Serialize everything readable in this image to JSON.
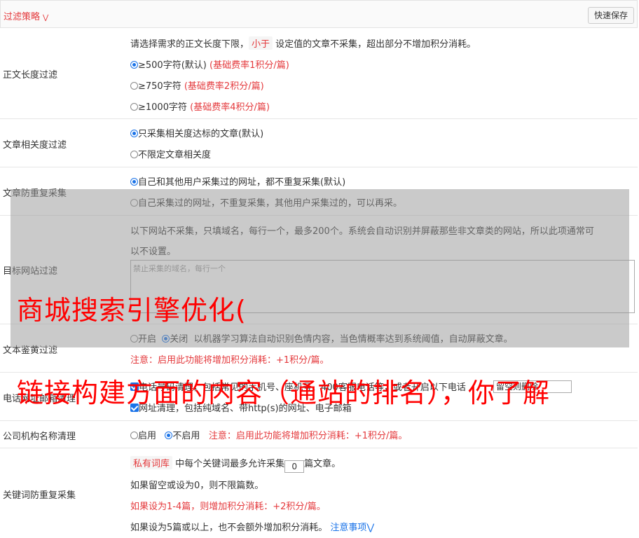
{
  "header": {
    "title": "过滤策略",
    "save_label": "快速保存"
  },
  "length": {
    "label": "正文长度过滤",
    "desc_a": "请选择需求的正文长度下限，",
    "desc_tag": "小于",
    "desc_b": "设定值的文章不采集，超出部分不增加积分消耗。",
    "options": [
      {
        "text": "≥500字符(默认)",
        "note": "(基础费率1积分/篇)",
        "selected": true
      },
      {
        "text": "≥750字符",
        "note": "(基础费率2积分/篇)",
        "selected": false
      },
      {
        "text": "≥1000字符",
        "note": "(基础费率4积分/篇)",
        "selected": false
      }
    ]
  },
  "relevance": {
    "label": "文章相关度过滤",
    "options": [
      "只采集相关度达标的文章(默认)",
      "不限定文章相关度"
    ]
  },
  "dedupe": {
    "label": "文章防重复采集",
    "options": [
      "自己和其他用户采集过的网址，都不重复采集(默认)",
      "自己采集过的网址，不重复采集，其他用户采集过的，可以再采。"
    ]
  },
  "site": {
    "label": "目标网站过滤",
    "desc_1": "以下网站不采集，只填域名，每行一个，最多200个。系统会自动识别并屏蔽那些非文章类的网站，所以此项通常可",
    "desc_2": "以不设置。",
    "placeholder": "禁止采集的域名，每行一个"
  },
  "porn": {
    "label": "文本鉴黄过滤",
    "on": "开启",
    "off": "关闭",
    "desc": "以机器学习算法自动识别色情内容，当色情概率达到系统阈值，自动屏蔽文章。",
    "note": "注意：启用此功能将增加积分消耗：+1积分/篇。"
  },
  "phone": {
    "label": "电话网址邮箱清理",
    "check1": "电话号码清理，包括常见的手机号、座机号、400客服电话等，或者开启以下电话",
    "keep_placeholder": "留空则删除",
    "check2": "网址清理，包括纯域名、带http(s)的网址、电子邮箱"
  },
  "company": {
    "label": "公司机构名称清理",
    "on": "启用",
    "off": "不启用",
    "note": "注意：启用此功能将增加积分消耗：+1积分/篇。"
  },
  "keyword": {
    "label": "关键词防重复采集",
    "tag": "私有词库",
    "line1_a": "中每个关键词最多允许采集",
    "value": "0",
    "line1_b": "篇文章。",
    "line2": "如果留空或设为0，则不限篇数。",
    "line3": "如果设为1-4篇，则增加积分消耗：+2积分/篇。",
    "line4": "如果设为5篇或以上，也不会额外增加积分消耗。",
    "link": "注意事项"
  },
  "watermark": {
    "line1": "商城搜索引擎优化(",
    "line2": "链接构建方面的内容（通站的排名），你了解"
  }
}
